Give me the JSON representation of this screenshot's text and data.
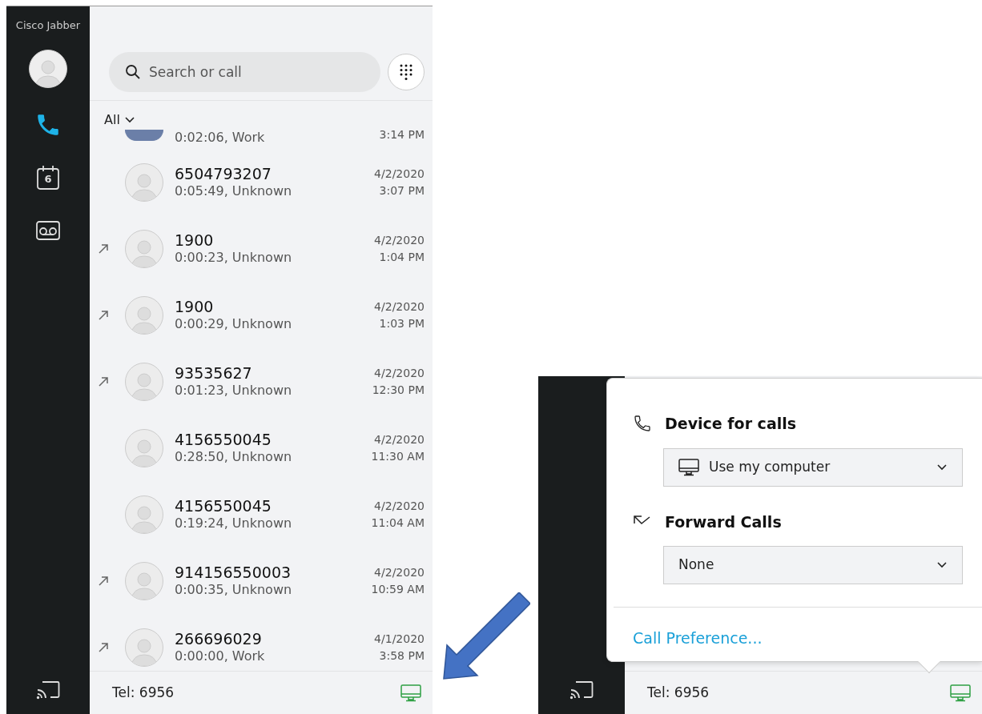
{
  "app": {
    "title": "Cisco Jabber"
  },
  "nav": [
    {
      "kind": "calls",
      "selected": true
    },
    {
      "kind": "calendar",
      "badge": "6",
      "selected": false
    },
    {
      "kind": "voicemail",
      "selected": false
    }
  ],
  "search": {
    "placeholder": "Search or call"
  },
  "filter": {
    "label": "All"
  },
  "calls": [
    {
      "kind": "photo",
      "outgoing": false,
      "detail": "0:02:06, Work",
      "time": "3:14 PM"
    },
    {
      "kind": "default",
      "outgoing": false,
      "number": "6504793207",
      "detail": "0:05:49, Unknown",
      "date": "4/2/2020",
      "time": "3:07 PM"
    },
    {
      "kind": "default",
      "outgoing": true,
      "number": "1900",
      "detail": "0:00:23, Unknown",
      "date": "4/2/2020",
      "time": "1:04 PM"
    },
    {
      "kind": "default",
      "outgoing": true,
      "number": "1900",
      "detail": "0:00:29, Unknown",
      "date": "4/2/2020",
      "time": "1:03 PM"
    },
    {
      "kind": "default",
      "outgoing": true,
      "number": "93535627",
      "detail": "0:01:23, Unknown",
      "date": "4/2/2020",
      "time": "12:30 PM"
    },
    {
      "kind": "default",
      "outgoing": false,
      "number": "4156550045",
      "detail": "0:28:50, Unknown",
      "date": "4/2/2020",
      "time": "11:30 AM"
    },
    {
      "kind": "default",
      "outgoing": false,
      "number": "4156550045",
      "detail": "0:19:24, Unknown",
      "date": "4/2/2020",
      "time": "11:04 AM"
    },
    {
      "kind": "default",
      "outgoing": true,
      "number": "914156550003",
      "detail": "0:00:35, Unknown",
      "date": "4/2/2020",
      "time": "10:59 AM"
    },
    {
      "kind": "default",
      "outgoing": true,
      "number": "266696029",
      "detail": "0:00:00, Work",
      "date": "4/1/2020",
      "time": "3:58 PM"
    }
  ],
  "status_bar": {
    "phone": "Tel: 6956"
  },
  "popup": {
    "device_title": "Device for calls",
    "device_value": "Use my computer",
    "forward_title": "Forward Calls",
    "forward_value": "None",
    "link": "Call Preference...",
    "status_bar": {
      "phone": "Tel: 6956"
    }
  }
}
